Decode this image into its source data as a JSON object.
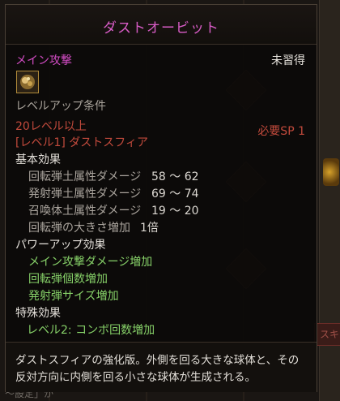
{
  "tooltip": {
    "title": "ダストオービット",
    "type_label": "メイン攻撃",
    "status": "未習得",
    "icon": "dust-orbit-skill-icon",
    "level_up_heading": "レベルアップ条件",
    "req_level": "20レベル以上",
    "req_sp": "必要SP 1",
    "req_skill": "[レベル1] ダストスフィア",
    "basic_heading": "基本効果",
    "stats": [
      {
        "name": "回転弾土属性ダメージ",
        "value": "58 ～ 62"
      },
      {
        "name": "発射弾土属性ダメージ",
        "value": "69 ～ 74"
      },
      {
        "name": "召喚体土属性ダメージ",
        "value": "19 ～ 20"
      },
      {
        "name": "回転弾の大きさ増加",
        "value": "1倍"
      }
    ],
    "powerup_heading": "パワーアップ効果",
    "powerups": [
      "メイン攻撃ダメージ増加",
      "回転弾個数増加",
      "発射弾サイズ増加"
    ],
    "special_heading": "特殊効果",
    "special_item": "レベル2: コンボ回数増加",
    "description": "ダストスフィアの強化版。外側を回る大きな球体と、その反対方向に内側を回る小さな球体が生成される。"
  },
  "background": {
    "skill_reset_button": "スキル初期化",
    "bottom_text": "～設定」か"
  },
  "colors": {
    "title": "#d85cc6",
    "type_label": "#d24cc3",
    "requirement": "#c24a3c",
    "powerup": "#88d06a"
  }
}
